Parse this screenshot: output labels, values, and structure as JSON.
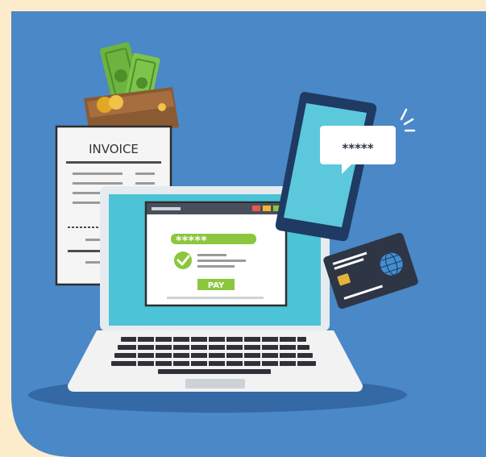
{
  "invoice": {
    "title": "INVOICE"
  },
  "payment_window": {
    "password_mask": "*****",
    "pay_button_label": "PAY"
  },
  "phone": {
    "password_bubble": "*****"
  },
  "colors": {
    "page_background": "#fdeccb",
    "panel_blue": "#4a88c7",
    "accent_green": "#8cc63f",
    "card_dark": "#2e3545",
    "phone_navy": "#1f3a63"
  }
}
